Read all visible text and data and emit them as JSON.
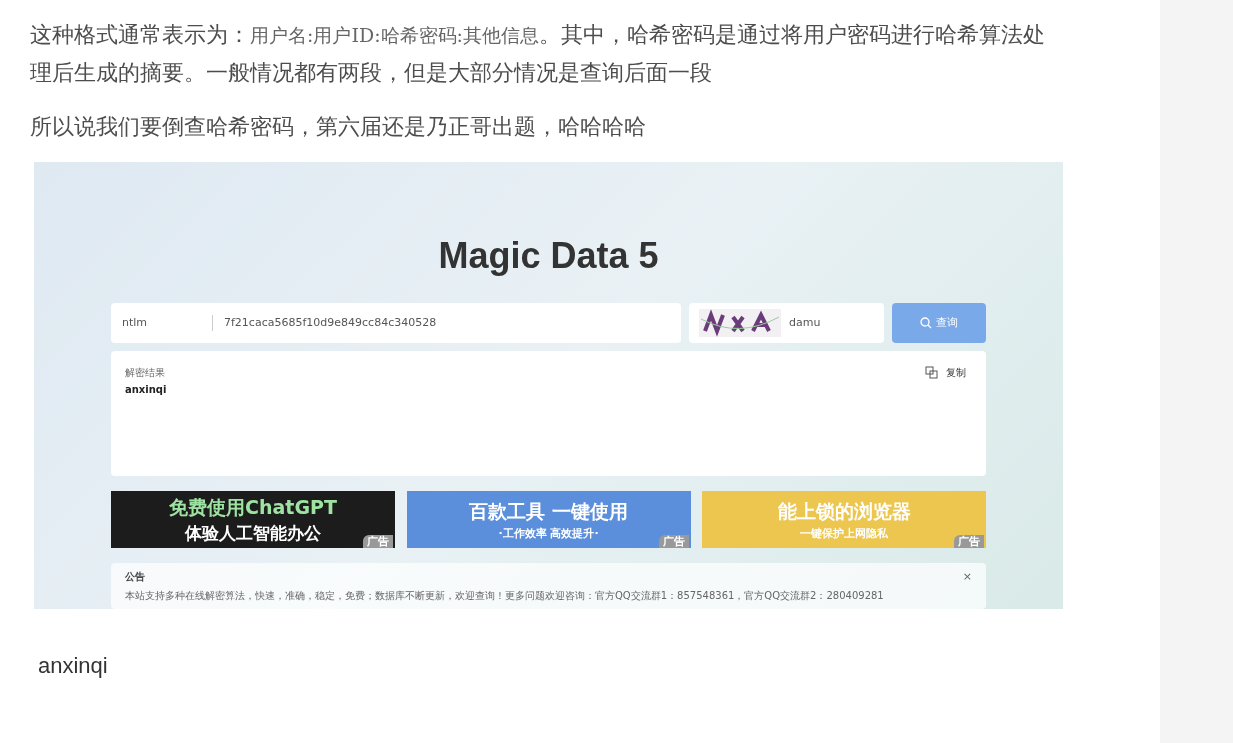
{
  "article": {
    "paragraphs": [
      {
        "parts": [
          {
            "kind": "plain",
            "text": "这种格式通常表示为："
          },
          {
            "kind": "code",
            "text": "用户名:用户ID:哈希密码:其他信息"
          },
          {
            "kind": "plain",
            "text": "。其中，哈希密码是通过将用户密码进行哈希算法处理后生成的摘要。一般情况都有两段，但是大部分情况是查询后面一段"
          }
        ]
      },
      {
        "parts": [
          {
            "kind": "plain",
            "text": "所以说我们要倒查哈希密码，第六届还是乃正哥出题，哈哈哈哈"
          }
        ]
      }
    ],
    "screenshot": {
      "title": "Magic Data 5",
      "hash_type": "ntlm",
      "hash_value": "7f21caca5685f10d9e849cc84c340528",
      "captcha_value": "damu",
      "query_button": "查询",
      "result": {
        "label": "解密结果",
        "value": "anxinqi",
        "copy_button": "复制"
      },
      "banners": [
        {
          "line_1": "免费使用ChatGPT",
          "line_2": "体验人工智能办公",
          "tag": "广告",
          "color": "#1c1c1c"
        },
        {
          "line_1": "百款工具 一键使用",
          "line_2": "·工作效率 高效提升·",
          "tag": "广告",
          "color": "#5b8fdc"
        },
        {
          "line_1": "能上锁的浏览器",
          "line_2": "一键保护上网隐私",
          "tag": "广告",
          "color": "#ecc64f"
        }
      ],
      "notice": {
        "title": "公告",
        "close": "×",
        "text": "本站支持多种在线解密算法，快速，准确，稳定，免费；数据库不断更新，欢迎查询！更多问题欢迎咨询：官方QQ交流群1：857548361，官方QQ交流群2：280409281"
      }
    },
    "result_text": "anxinqi"
  }
}
